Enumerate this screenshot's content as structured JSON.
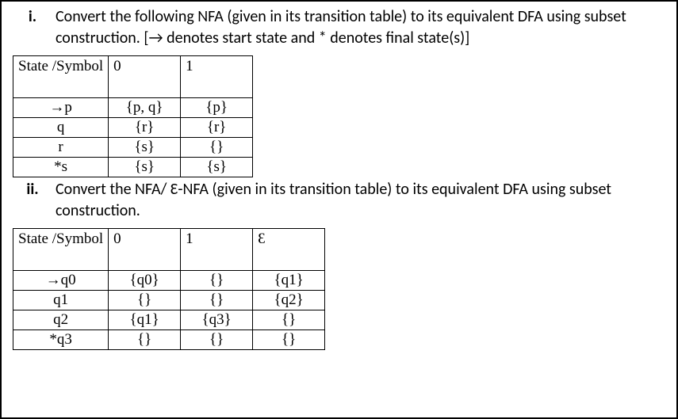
{
  "q1": {
    "marker": "i.",
    "text": "Convert the following NFA (given in its transition table) to its equivalent DFA using subset construction. [→ denotes start state and * denotes final state(s)]"
  },
  "t1": {
    "header": {
      "state": "State /Symbol",
      "c0": "0",
      "c1": "1"
    },
    "rows": [
      {
        "state": "→p",
        "c0": "{p, q}",
        "c1": "{p}"
      },
      {
        "state": "q",
        "c0": "{r}",
        "c1": "{r}"
      },
      {
        "state": "r",
        "c0": "{s}",
        "c1": "{}"
      },
      {
        "state": "*s",
        "c0": "{s}",
        "c1": "{s}"
      }
    ]
  },
  "q2": {
    "marker": "ii.",
    "text": "Convert the NFA/ Ɛ-NFA (given in its transition table) to its equivalent DFA using subset construction."
  },
  "t2": {
    "header": {
      "state": "State /Symbol",
      "c0": "0",
      "c1": "1",
      "ce": "Ɛ"
    },
    "rows": [
      {
        "state": "→q0",
        "c0": "{q0}",
        "c1": "{}",
        "ce": "{q1}"
      },
      {
        "state": "q1",
        "c0": "{}",
        "c1": "{}",
        "ce": "{q2}"
      },
      {
        "state": "q2",
        "c0": "{q1}",
        "c1": "{q3}",
        "ce": "{}"
      },
      {
        "state": "*q3",
        "c0": "{}",
        "c1": "{}",
        "ce": "{}"
      }
    ]
  }
}
